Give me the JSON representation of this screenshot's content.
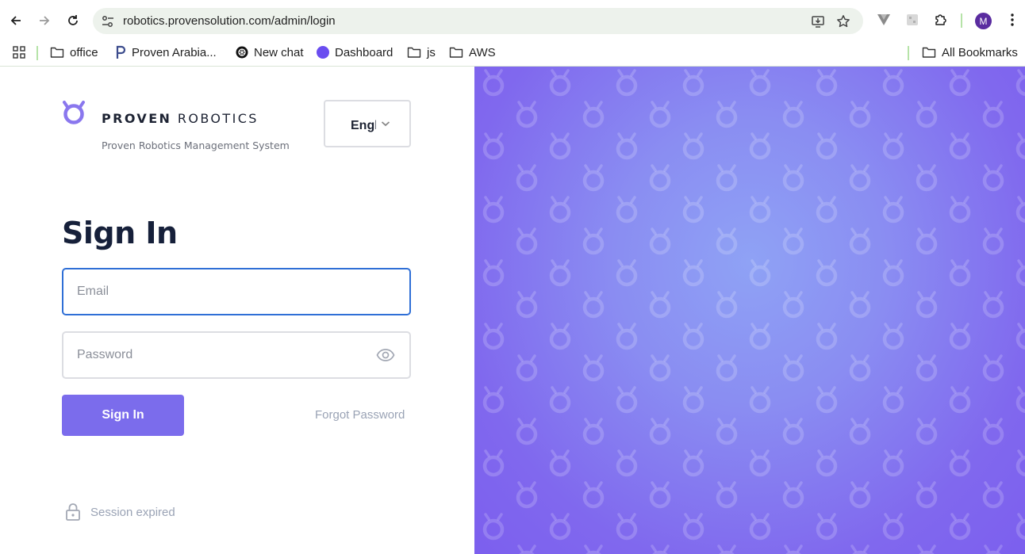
{
  "browser": {
    "url": "robotics.provensolution.com/admin/login",
    "profile_initial": "M",
    "bookmarks": [
      {
        "label": "office",
        "icon": "folder-icon"
      },
      {
        "label": "Proven Arabia...",
        "icon": "proven-favicon"
      },
      {
        "label": "New chat",
        "icon": "openai-favicon"
      },
      {
        "label": "Dashboard",
        "icon": "purple-dot-favicon"
      },
      {
        "label": "js",
        "icon": "folder-icon"
      },
      {
        "label": "AWS",
        "icon": "folder-icon"
      }
    ],
    "all_bookmarks_label": "All Bookmarks"
  },
  "brand": {
    "name_bold": "PROVEN",
    "name_light": "ROBOTICS",
    "subtitle": "Proven Robotics Management System",
    "color": "#8a77ee"
  },
  "language": {
    "selected": "English"
  },
  "form": {
    "title": "Sign In",
    "email_placeholder": "Email",
    "password_placeholder": "Password",
    "submit_label": "Sign In",
    "forgot_label": "Forgot Password"
  },
  "status": {
    "session_label": "Session expired"
  },
  "colors": {
    "accent": "#7b6cec",
    "panel_gradient_center": "#8fa2f5",
    "panel_gradient_edge": "#7c5fee",
    "focus_border": "#2f6fd6"
  }
}
